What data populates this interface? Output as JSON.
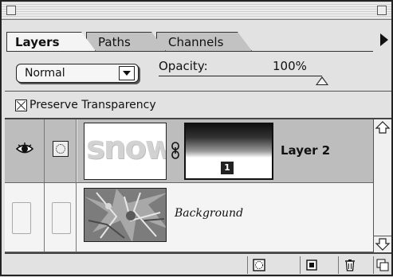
{
  "panel": {
    "tabs": [
      {
        "label": "Layers",
        "active": true
      },
      {
        "label": "Paths",
        "active": false
      },
      {
        "label": "Channels",
        "active": false
      }
    ]
  },
  "controls": {
    "blend_mode": "Normal",
    "opacity_label": "Opacity:",
    "opacity_value": "100%",
    "opacity_percent": 100,
    "preserve_transparency_label": "Preserve Transparency",
    "preserve_transparency_checked": true
  },
  "layers": [
    {
      "name": "Layer 2",
      "visible": true,
      "selected": true,
      "thumbnail_text": "snow",
      "mask_badge": "1"
    },
    {
      "name": "Background",
      "visible": false,
      "selected": false
    }
  ],
  "icons": {
    "visibility": "eye-icon",
    "brush": "brush-icon",
    "link": "chain-icon",
    "mask": "layer-mask-icon",
    "new_layer": "new-layer-icon",
    "delete": "trash-icon",
    "tab_menu": "menu-arrow-icon"
  },
  "colors": {
    "selected_row": "#bdbdbd",
    "panel_bg": "#e2e2e2"
  }
}
